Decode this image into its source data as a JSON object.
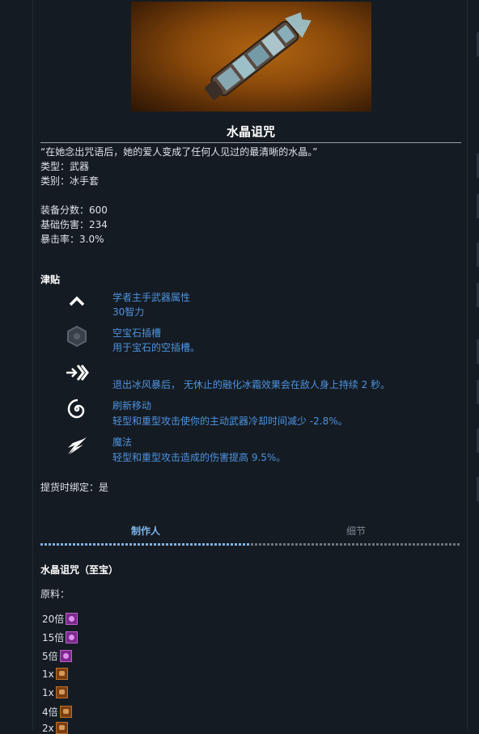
{
  "item": {
    "name": "水晶诅咒",
    "flavor": "“在她念出咒语后，她的爱人变成了任何人见过的最清晰的水晶。”",
    "type_line": "类型：武器",
    "category_line": "类别：冰手套",
    "gear_score_line": "装备分数：600",
    "base_damage_line": "基础伤害：234",
    "crit_line": "暴击率：3.0%"
  },
  "perks_heading": "津贴",
  "perks": [
    {
      "icon": "chevron-up-icon",
      "title": "学者主手武器属性",
      "desc": "30智力"
    },
    {
      "icon": "gem-socket-icon",
      "title": "空宝石插槽",
      "desc": "用于宝石的空插槽。"
    },
    {
      "icon": "arrow-burst-icon",
      "title": "",
      "desc": "退出冰风暴后， 无休止的融化冰霜效果会在敌人身上持续 2 秒。"
    },
    {
      "icon": "swirl-icon",
      "title": "刷新移动",
      "desc": "轻型和重型攻击使你的主动武器冷却时间减少 -2.8%。"
    },
    {
      "icon": "claw-icon",
      "title": "魔法",
      "desc": "轻型和重型攻击造成的伤害提高 9.5%。"
    }
  ],
  "bind_on_pickup": "提货时绑定：是",
  "tabs": {
    "crafter": "制作人",
    "details": "细节"
  },
  "recipe": {
    "title": "水晶诅咒（至宝）",
    "materials_label": "原料：",
    "materials": [
      {
        "qty": "20倍",
        "color": "purple"
      },
      {
        "qty": "15倍",
        "color": "purple"
      },
      {
        "qty": "5倍",
        "color": "purple"
      },
      {
        "qty": "1x",
        "color": "orange"
      },
      {
        "qty": "1x",
        "color": "orange"
      },
      {
        "qty": "4倍",
        "color": "orange"
      },
      {
        "qty": "2x",
        "color": "orange"
      }
    ]
  },
  "colors": {
    "background": "#151b22",
    "link_blue": "#4d93e0",
    "tab_active": "#7fb3e8"
  }
}
